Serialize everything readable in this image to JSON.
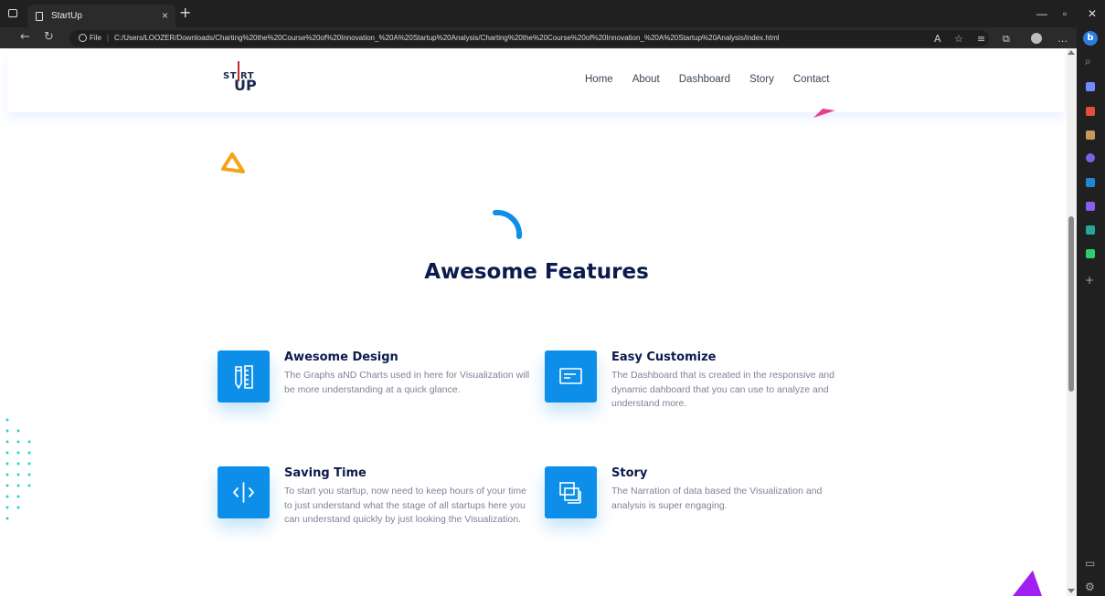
{
  "browser": {
    "tab_title": "StartUp",
    "url_prefix": "File",
    "url": "C:/Users/LOOZER/Downloads/Charting%20the%20Course%20of%20Innovation_%20A%20Startup%20Analysis/Charting%20the%20Course%20of%20Innovation_%20A%20Startup%20Analysis/index.html"
  },
  "site": {
    "logo_top": "ST RT",
    "logo_bottom": "UP",
    "nav": [
      "Home",
      "About",
      "Dashboard",
      "Story",
      "Contact"
    ]
  },
  "section": {
    "title": "Awesome Features"
  },
  "features": [
    {
      "title": "Awesome Design",
      "description": "The Graphs aND Charts used in here for Visualization will be more understanding at a quick glance.",
      "icon": "ruler-pencil-icon"
    },
    {
      "title": "Easy Customize",
      "description": "The Dashboard that is created in the responsive and dynamic dahboard that you can use to analyze and understand more.",
      "icon": "window-card-icon"
    },
    {
      "title": "Saving Time",
      "description": "To start you startup, now need to keep hours of your time to just understand what the stage of all startups here you can understand quickly by just looking the Visualization.",
      "icon": "code-split-icon"
    },
    {
      "title": "Story",
      "description": "The Narration of data based the Visualization and analysis is super engaging.",
      "icon": "stacked-windows-icon"
    }
  ],
  "colors": {
    "accent": "#0d8ee9",
    "heading": "#0c1b4d",
    "body_text": "#7b8494",
    "triangle_orange": "#f5a31a",
    "triangle_pink": "#e83e8c",
    "triangle_purple": "#a020f0",
    "dots": "#28d3c6"
  }
}
